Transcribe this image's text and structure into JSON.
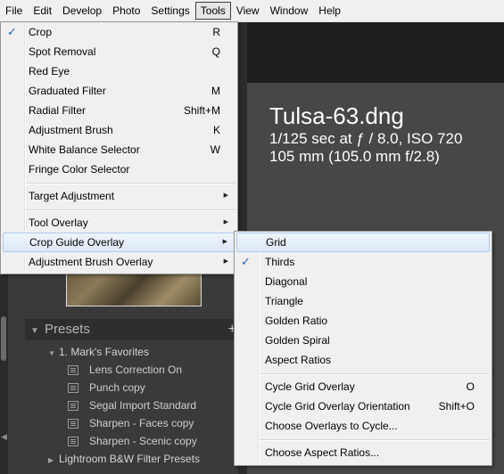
{
  "menubar": {
    "items": [
      {
        "label": "File"
      },
      {
        "label": "Edit"
      },
      {
        "label": "Develop"
      },
      {
        "label": "Photo"
      },
      {
        "label": "Settings"
      },
      {
        "label": "Tools"
      },
      {
        "label": "View"
      },
      {
        "label": "Window"
      },
      {
        "label": "Help"
      }
    ],
    "open_item": "Tools"
  },
  "photo_info": {
    "filename": "Tulsa-63.dng",
    "exposure_line": "1/125 sec at ƒ / 8.0, ISO 720",
    "lens_line": "105 mm (105.0 mm f/2.8)"
  },
  "tools_menu": {
    "items": [
      {
        "label": "Crop",
        "shortcut": "R",
        "checked": true
      },
      {
        "label": "Spot Removal",
        "shortcut": "Q"
      },
      {
        "label": "Red Eye",
        "shortcut": ""
      },
      {
        "label": "Graduated Filter",
        "shortcut": "M"
      },
      {
        "label": "Radial Filter",
        "shortcut": "Shift+M"
      },
      {
        "label": "Adjustment Brush",
        "shortcut": "K"
      },
      {
        "label": "White Balance Selector",
        "shortcut": "W"
      },
      {
        "label": "Fringe Color Selector",
        "shortcut": ""
      },
      {
        "label": "Target Adjustment",
        "submenu": true
      },
      {
        "label": "Tool Overlay",
        "submenu": true
      },
      {
        "label": "Crop Guide Overlay",
        "submenu": true,
        "highlighted": true
      },
      {
        "label": "Adjustment Brush Overlay",
        "submenu": true
      }
    ]
  },
  "crop_guide_submenu": {
    "items": [
      {
        "label": "Grid",
        "highlighted": true
      },
      {
        "label": "Thirds",
        "checked": true
      },
      {
        "label": "Diagonal"
      },
      {
        "label": "Triangle"
      },
      {
        "label": "Golden Ratio"
      },
      {
        "label": "Golden Spiral"
      },
      {
        "label": "Aspect Ratios"
      },
      {
        "label": "Cycle Grid Overlay",
        "shortcut": "O"
      },
      {
        "label": "Cycle Grid Overlay Orientation",
        "shortcut": "Shift+O"
      },
      {
        "label": "Choose Overlays to Cycle..."
      },
      {
        "label": "Choose Aspect Ratios..."
      }
    ]
  },
  "presets_panel": {
    "title": "Presets",
    "add_symbol": "+",
    "folders": [
      {
        "label": "1. Mark's Favorites",
        "expanded": true,
        "presets": [
          "Lens Correction On",
          "Punch copy",
          "Segal Import Standard",
          "Sharpen - Faces copy",
          "Sharpen - Scenic copy"
        ]
      },
      {
        "label": "Lightroom B&W Filter Presets",
        "expanded": false
      }
    ]
  },
  "glyphs": {
    "check": "✓",
    "submenu_arrow": "▶",
    "expanded": "▼",
    "collapsed": "▶",
    "panel_collapse": "◀"
  },
  "colors": {
    "menu_bg": "#f0f0f0",
    "highlight": "#dde9f7",
    "check": "#1c5fbf",
    "panel_bg": "#3a3a3a",
    "main_bg": "#474747"
  }
}
